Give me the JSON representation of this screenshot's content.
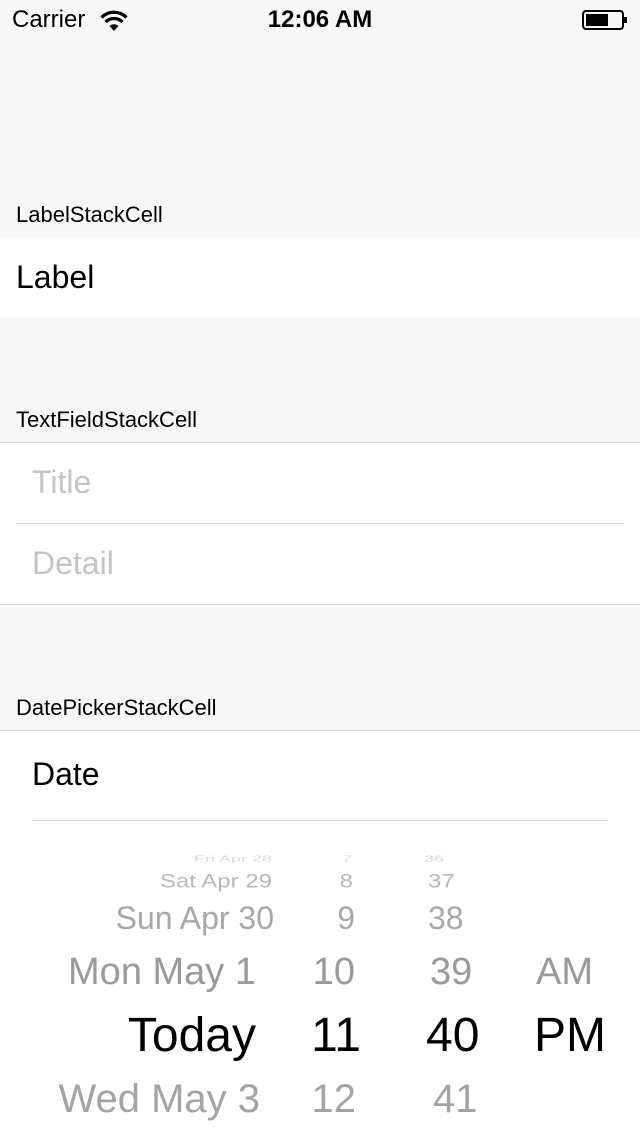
{
  "status_bar": {
    "carrier": "Carrier",
    "time": "12:06 AM",
    "icons": [
      "wifi-icon",
      "battery-icon"
    ]
  },
  "sections": {
    "label_stack": {
      "header": "LabelStackCell",
      "label": "Label"
    },
    "text_field_stack": {
      "header": "TextFieldStackCell",
      "title_placeholder": "Title",
      "detail_placeholder": "Detail"
    },
    "date_picker_stack": {
      "header": "DatePickerStackCell",
      "label": "Date",
      "picker": {
        "day_column": [
          "Fri Apr 28",
          "Sat Apr 29",
          "Sun Apr 30",
          "Mon May 1",
          "Today",
          "Wed May 3"
        ],
        "hour_column": [
          "7",
          "8",
          "9",
          "10",
          "11",
          "12"
        ],
        "minute_column": [
          "36",
          "37",
          "38",
          "39",
          "40",
          "41"
        ],
        "period_column": [
          "AM",
          "PM"
        ],
        "selected": {
          "day": "Today",
          "hour": "11",
          "minute": "40",
          "period": "PM"
        }
      }
    }
  },
  "colors": {
    "background": "#f7f7f7",
    "cell": "#ffffff",
    "separator": "#d6d6d6",
    "placeholder": "#c4c4c8",
    "picker_unselected": "#9a9a9a"
  }
}
